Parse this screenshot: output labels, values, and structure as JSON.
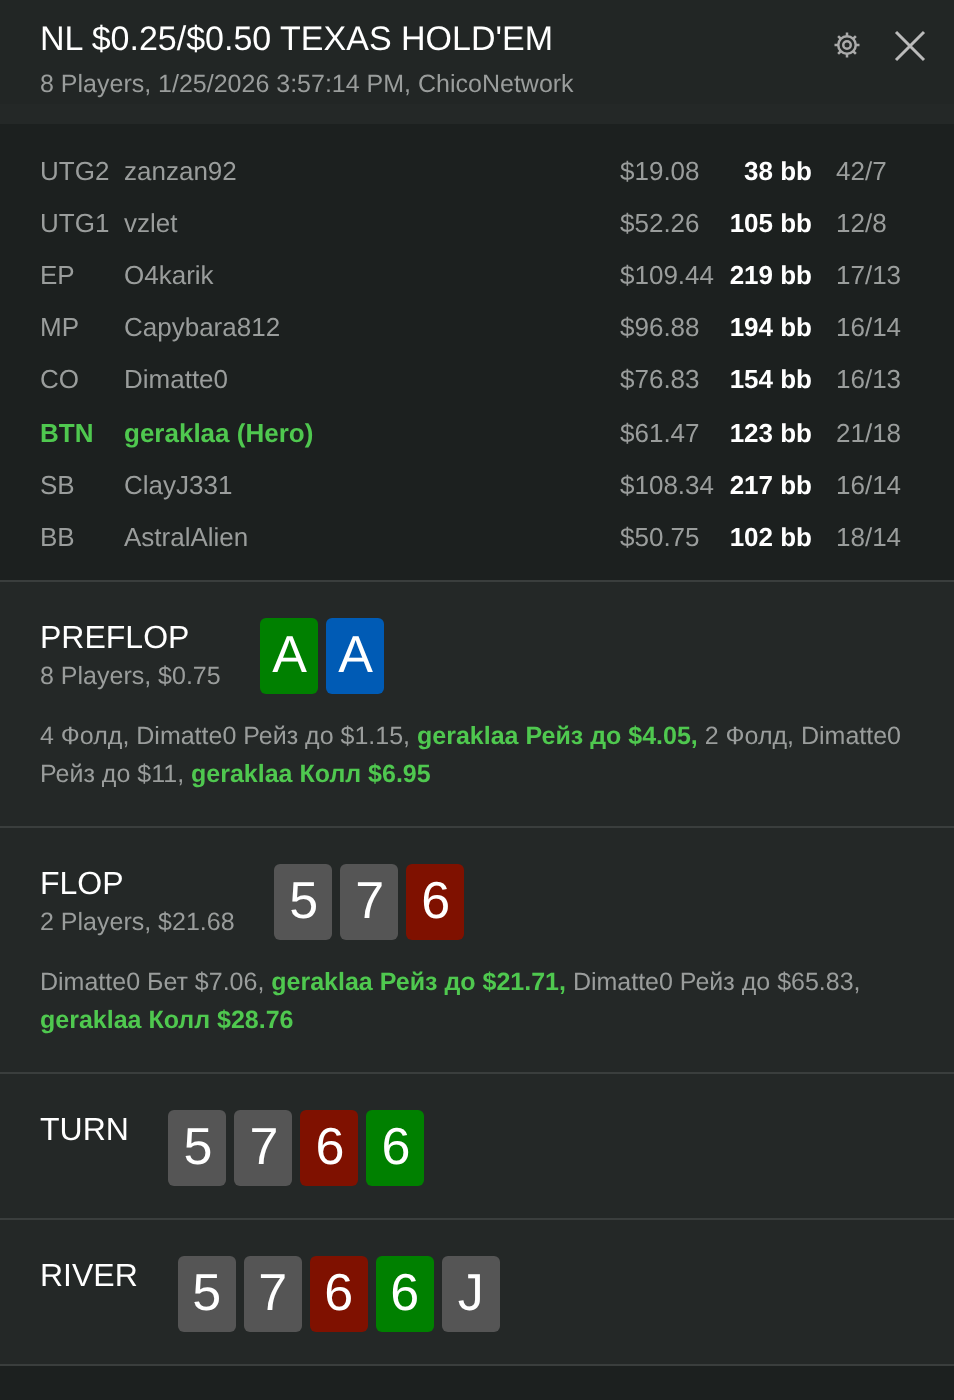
{
  "header": {
    "title": "NL $0.25/$0.50 TEXAS HOLD'EM",
    "subtitle": "8 Players, 1/25/2026 3:57:14 PM, ChicoNetwork"
  },
  "players": [
    {
      "position": "UTG2",
      "name": "zanzan92",
      "stack": "$19.08",
      "bb": "38 bb",
      "stats": "42/7",
      "hero": false
    },
    {
      "position": "UTG1",
      "name": "vzlet",
      "stack": "$52.26",
      "bb": "105 bb",
      "stats": "12/8",
      "hero": false
    },
    {
      "position": "EP",
      "name": "O4karik",
      "stack": "$109.44",
      "bb": "219 bb",
      "stats": "17/13",
      "hero": false
    },
    {
      "position": "MP",
      "name": "Capybara812",
      "stack": "$96.88",
      "bb": "194 bb",
      "stats": "16/14",
      "hero": false
    },
    {
      "position": "CO",
      "name": "Dimatte0",
      "stack": "$76.83",
      "bb": "154 bb",
      "stats": "16/13",
      "hero": false
    },
    {
      "position": "BTN",
      "name": "geraklaa (Hero)",
      "stack": "$61.47",
      "bb": "123 bb",
      "stats": "21/18",
      "hero": true
    },
    {
      "position": "SB",
      "name": "ClayJ331",
      "stack": "$108.34",
      "bb": "217 bb",
      "stats": "16/14",
      "hero": false
    },
    {
      "position": "BB",
      "name": "AstralAlien",
      "stack": "$50.75",
      "bb": "102 bb",
      "stats": "18/14",
      "hero": false
    }
  ],
  "streets": [
    {
      "title": "PREFLOP",
      "subtitle": "8 Players, $0.75",
      "cards": [
        {
          "rank": "A",
          "color": "#008000"
        },
        {
          "rank": "A",
          "color": "#005bb5"
        }
      ],
      "actions": "4 Фолд, Dimatte0 Рейз до $1.15, **geraklaa Рейз до $4.05,** 2 Фолд, Dimatte0 Рейз до $11, **geraklaa Колл $6.95**"
    },
    {
      "title": "FLOP",
      "subtitle": "2 Players, $21.68",
      "cards": [
        {
          "rank": "5",
          "color": "#555555"
        },
        {
          "rank": "7",
          "color": "#555555"
        },
        {
          "rank": "6",
          "color": "#7f1100"
        }
      ],
      "actions": "Dimatte0 Бет $7.06, **geraklaa Рейз до $21.71,** Dimatte0 Рейз до $65.83, **geraklaa Колл $28.76**"
    },
    {
      "title": "TURN",
      "cards": [
        {
          "rank": "5",
          "color": "#555555"
        },
        {
          "rank": "7",
          "color": "#555555"
        },
        {
          "rank": "6",
          "color": "#7f1100"
        },
        {
          "rank": "6",
          "color": "#008000"
        }
      ]
    },
    {
      "title": "RIVER",
      "cards": [
        {
          "rank": "5",
          "color": "#555555"
        },
        {
          "rank": "7",
          "color": "#555555"
        },
        {
          "rank": "6",
          "color": "#7f1100"
        },
        {
          "rank": "6",
          "color": "#008000"
        },
        {
          "rank": "J",
          "color": "#555555"
        }
      ]
    }
  ]
}
